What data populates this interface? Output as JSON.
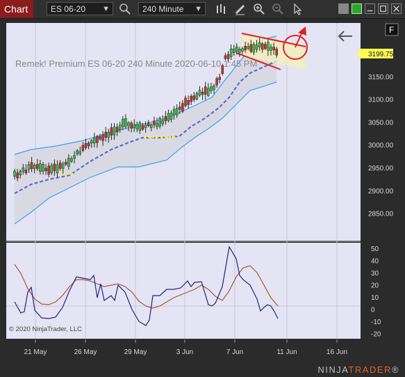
{
  "toolbar": {
    "tab_label": "Chart",
    "instrument": "ES 06-20",
    "interval": "240 Minute",
    "icons": [
      "search-icon",
      "bar-style-icon",
      "drawing-tool-icon",
      "zoom-in-icon",
      "zoom-out-icon",
      "pointer-icon",
      "window-gray-icon",
      "window-green-icon",
      "minimize-icon",
      "maximize-icon",
      "close-icon"
    ]
  },
  "chart": {
    "label": "Remek!  Premium  ES 06-20  240 Minute  2020-06-10 1:45 PM",
    "copyright": "© 2020 NinjaTrader, LLC",
    "panel_button": "F",
    "last_price": "3199.75",
    "colors": {
      "background": "#e4e4f4",
      "band_fill": "#dcdce8",
      "band_line": "#3aa0f0",
      "midline": "#5a6ad0",
      "price_box": "#ffff55",
      "channel": "#e02020",
      "osc_fast": "#202080",
      "osc_slow": "#a05a30"
    }
  },
  "price_axis": {
    "ticks": [
      "3200.00",
      "3150.00",
      "3100.00",
      "3050.00",
      "3000.00",
      "2950.00",
      "2900.00",
      "2850.00"
    ]
  },
  "osc_axis": {
    "ticks": [
      "50",
      "40",
      "30",
      "20",
      "10",
      "0",
      "-10",
      "-20"
    ]
  },
  "time_axis": {
    "ticks": [
      "21 May",
      "26 May",
      "29 May",
      "3 Jun",
      "7 Jun",
      "11 Jun",
      "16 Jun"
    ]
  },
  "footer": {
    "brand_1": "NINJA",
    "brand_2": "TRADER",
    "brand_suffix": "®"
  }
}
